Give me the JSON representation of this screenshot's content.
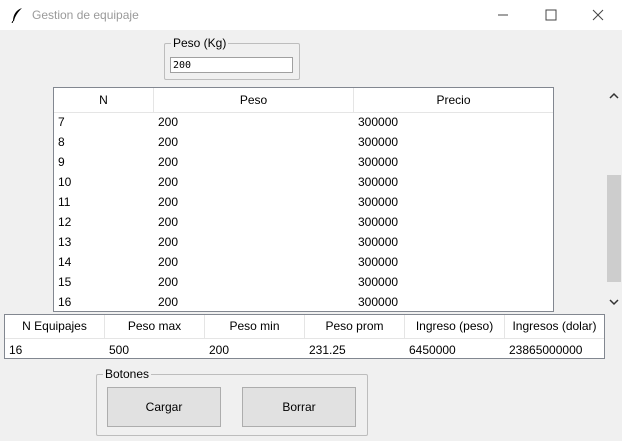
{
  "window": {
    "title": "Gestion de equipaje",
    "controls": [
      "minimize-icon",
      "maximize-icon",
      "close-icon"
    ]
  },
  "peso_group": {
    "legend": "Peso (Kg)",
    "input_value": "200"
  },
  "equipaje_table": {
    "columns": [
      "N",
      "Peso",
      "Precio"
    ],
    "rows": [
      [
        "7",
        "200",
        "300000"
      ],
      [
        "8",
        "200",
        "300000"
      ],
      [
        "9",
        "200",
        "300000"
      ],
      [
        "10",
        "200",
        "300000"
      ],
      [
        "11",
        "200",
        "300000"
      ],
      [
        "12",
        "200",
        "300000"
      ],
      [
        "13",
        "200",
        "300000"
      ],
      [
        "14",
        "200",
        "300000"
      ],
      [
        "15",
        "200",
        "300000"
      ],
      [
        "16",
        "200",
        "300000"
      ]
    ]
  },
  "stats_table": {
    "columns": [
      "N Equipajes",
      "Peso max",
      "Peso min",
      "Peso prom",
      "Ingreso (peso)",
      "Ingresos (dolar)"
    ],
    "values": [
      "16",
      "500",
      "200",
      "231.25",
      "6450000",
      "23865000000"
    ]
  },
  "botones_group": {
    "legend": "Botones",
    "cargar_label": "Cargar",
    "borrar_label": "Borrar"
  }
}
